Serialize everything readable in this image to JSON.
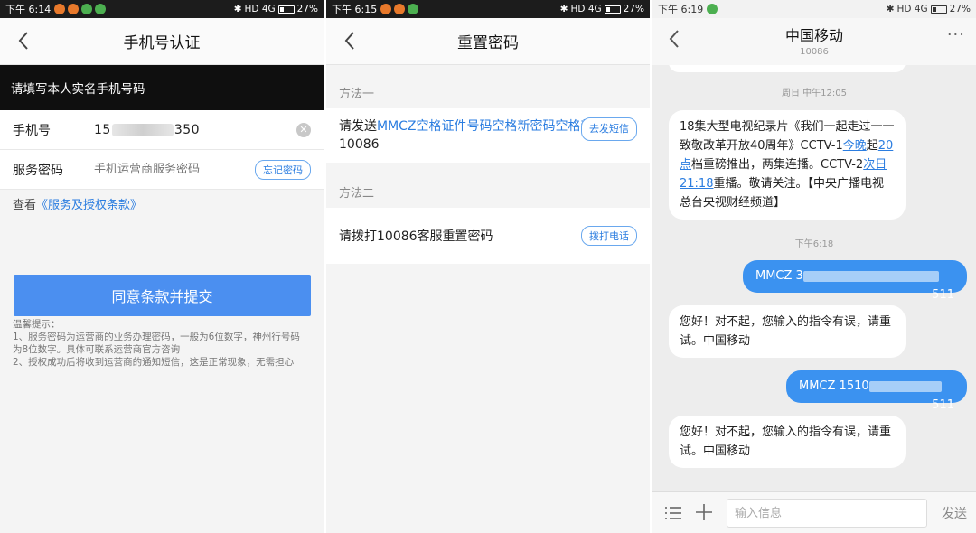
{
  "screen1": {
    "status": {
      "time": "下午 6:14",
      "network": "HD 4G",
      "battery": "27%"
    },
    "nav": {
      "title": "手机号认证"
    },
    "banner": "请填写本人实名手机号码",
    "phone": {
      "label": "手机号",
      "prefix": "15",
      "suffix": "350"
    },
    "password": {
      "label": "服务密码",
      "placeholder": "手机运营商服务密码",
      "forgot_button": "忘记密码"
    },
    "terms": {
      "prefix": "查看",
      "link": "《服务及授权条款》"
    },
    "submit_label": "同意条款并提交",
    "tips": {
      "heading": "温馨提示：",
      "line1": "1、服务密码为运营商的业务办理密码，一般为6位数字，神州行号码为8位数字。具体可联系运营商官方咨询",
      "line2": "2、授权成功后将收到运营商的通知短信，这是正常现象，无需担心"
    }
  },
  "screen2": {
    "status": {
      "time": "下午 6:15",
      "network": "HD 4G",
      "battery": "27%"
    },
    "nav": {
      "title": "重置密码"
    },
    "method1": {
      "title": "方法一",
      "text_prefix": "请发送",
      "link_text": "MMCZ空格证件号码空格新密码空格新密码",
      "text_suffix": "到10086",
      "button": "去发短信"
    },
    "method2": {
      "title": "方法二",
      "text": "请拨打10086客服重置密码",
      "button": "拨打电话"
    }
  },
  "screen3": {
    "status": {
      "time": "下午 6:19",
      "network": "HD 4G",
      "battery": "27%"
    },
    "nav": {
      "title": "中国移动",
      "subtitle": "10086",
      "more": "···"
    },
    "timestamp1": "周日 中午12:05",
    "msg1": {
      "part1": "18集大型电视纪录片《我们一起走过一一致敬改革开放40周年》CCTV-1",
      "link1": "今晚",
      "part2": "起",
      "link2": "20点",
      "part3": "档重磅推出，两集连播。CCTV-2",
      "link3": "次日21:18",
      "part4": "重播。敬请关注。【中央广播电视总台央视财经频道】"
    },
    "timestamp2": "下午6:18",
    "out1": {
      "prefix": "MMCZ 3",
      "suffix": "511"
    },
    "reply1": "您好！对不起，您输入的指令有误，请重试。中国移动",
    "out2": {
      "prefix": "MMCZ 1510",
      "suffix": "511"
    },
    "reply2": "您好！对不起，您输入的指令有误，请重试。中国移动",
    "composer": {
      "placeholder": "输入信息",
      "send": "发送"
    }
  },
  "colors": {
    "accent": "#4b8ff0",
    "link": "#2b7de0",
    "bubble_out": "#3b92f0"
  }
}
